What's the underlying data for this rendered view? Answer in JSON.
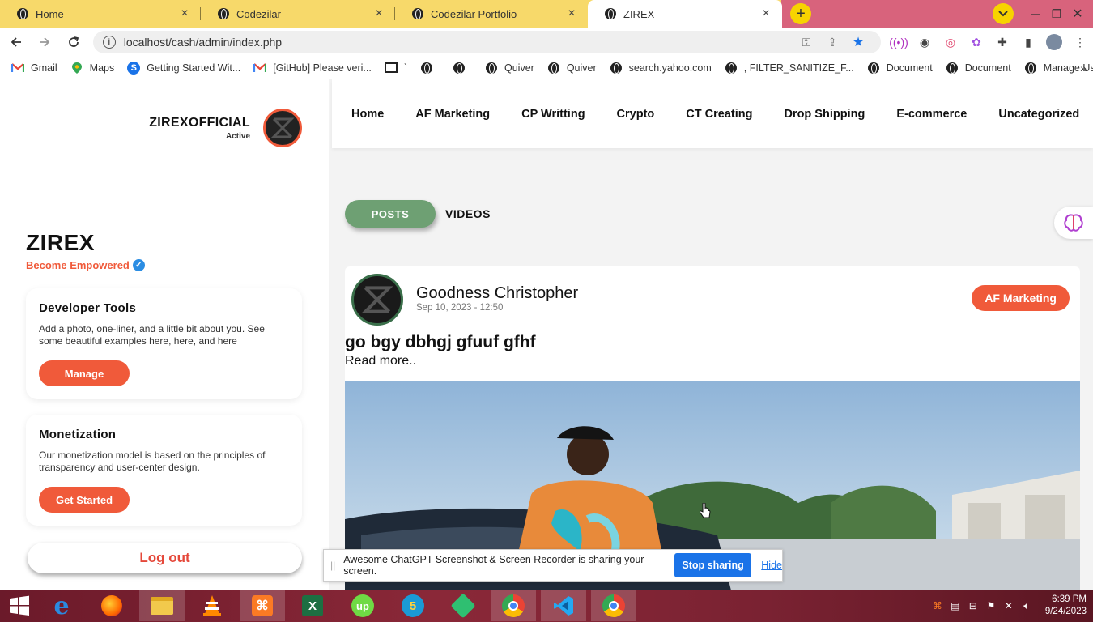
{
  "browser": {
    "tabs": [
      {
        "title": "Home",
        "active": false
      },
      {
        "title": "Codezilar",
        "active": false
      },
      {
        "title": "Codezilar Portfolio",
        "active": false
      },
      {
        "title": "ZIREX",
        "active": true
      }
    ],
    "url": "localhost/cash/admin/index.php",
    "bookmarks": [
      {
        "label": "Gmail",
        "icon": "gmail-icon"
      },
      {
        "label": "Maps",
        "icon": "maps-icon"
      },
      {
        "label": "Getting Started Wit...",
        "icon": "s-icon"
      },
      {
        "label": "[GitHub] Please veri...",
        "icon": "gmail-icon"
      },
      {
        "label": "`",
        "icon": "flag-icon"
      },
      {
        "label": "",
        "icon": "globe-icon"
      },
      {
        "label": "",
        "icon": "globe-icon"
      },
      {
        "label": "Quiver",
        "icon": "globe-icon"
      },
      {
        "label": "Quiver",
        "icon": "globe-icon"
      },
      {
        "label": "search.yahoo.com",
        "icon": "globe-icon"
      },
      {
        "label": ", FILTER_SANITIZE_F...",
        "icon": "globe-icon"
      },
      {
        "label": "Document",
        "icon": "globe-icon"
      },
      {
        "label": "Document",
        "icon": "globe-icon"
      },
      {
        "label": "Manage Users",
        "icon": "globe-icon"
      }
    ]
  },
  "sidebar": {
    "profile_name": "ZIREXOFFICIAL",
    "profile_status": "Active",
    "brand_title": "ZIREX",
    "brand_sub": "Become Empowered",
    "cards": [
      {
        "title": "Developer Tools",
        "text": "Add a photo, one-liner, and a little bit about you. See some beautiful examples here, here, and here",
        "button": "Manage"
      },
      {
        "title": "Monetization",
        "text": "Our monetization model is based on the principles of transparency and user-center design.",
        "button": "Get Started"
      }
    ],
    "logout": "Log out"
  },
  "nav": [
    "Home",
    "AF Marketing",
    "CP Writting",
    "Crypto",
    "CT Creating",
    "Drop Shipping",
    "E-commerce",
    "Uncategorized"
  ],
  "content_tabs": {
    "posts": "POSTS",
    "videos": "VIDEOS"
  },
  "post": {
    "author": "Goodness Christopher",
    "date": "Sep 10, 2023 - 12:50",
    "tag": "AF Marketing",
    "title": "go bgy dbhgj gfuuf gfhf",
    "read_more": "Read more.."
  },
  "share_bar": {
    "message": "Awesome ChatGPT Screenshot & Screen Recorder is sharing your screen.",
    "stop": "Stop sharing",
    "hide": "Hide"
  },
  "taskbar": {
    "time": "6:39 PM",
    "date": "9/24/2023"
  },
  "colors": {
    "accent": "#f05a3a",
    "posts_tab": "#6ea073",
    "tabbar": "#f7d96a",
    "share_button": "#1a73e8"
  }
}
